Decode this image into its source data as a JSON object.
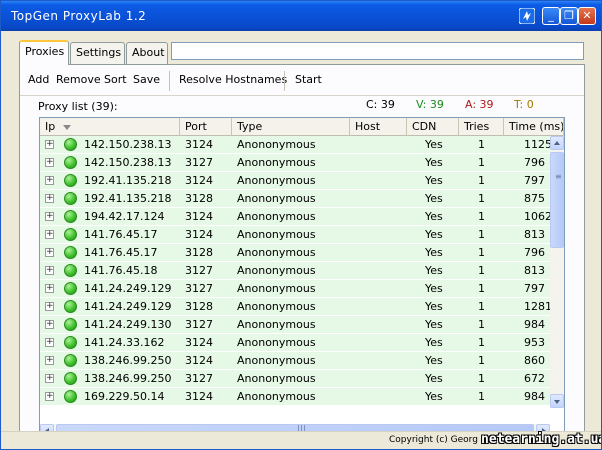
{
  "window": {
    "title": "TopGen ProxyLab 1.2",
    "controls": {
      "minimize": "_",
      "maximize": "❐",
      "close": "✕"
    }
  },
  "tabs": [
    {
      "label": "Proxies",
      "active": true
    },
    {
      "label": "Settings",
      "active": false
    },
    {
      "label": "About",
      "active": false
    }
  ],
  "top_input": {
    "value": ""
  },
  "toolbar": {
    "add": "Add",
    "remove": "Remove",
    "sort": "Sort",
    "save": "Save",
    "resolve": "Resolve Hostnames",
    "start": "Start"
  },
  "proxy_list": {
    "label": "Proxy list (39):",
    "counts": {
      "c": "C: 39",
      "v": "V: 39",
      "a": "A: 39",
      "t": "T: 0"
    },
    "count_colors": {
      "c": "#000000",
      "v": "#1a8a1a",
      "a": "#b01818",
      "t": "#a07a00"
    },
    "columns": [
      "Ip",
      "Port",
      "Type",
      "Host",
      "CDN",
      "Tries",
      "Time (ms)"
    ],
    "rows": [
      {
        "ip": "142.150.238.13",
        "port": "3124",
        "type": "Anononymous",
        "host": "",
        "cdn": "Yes",
        "tries": "1",
        "time": "1125"
      },
      {
        "ip": "142.150.238.13",
        "port": "3127",
        "type": "Anononymous",
        "host": "",
        "cdn": "Yes",
        "tries": "1",
        "time": "796"
      },
      {
        "ip": "192.41.135.218",
        "port": "3124",
        "type": "Anononymous",
        "host": "",
        "cdn": "Yes",
        "tries": "1",
        "time": "797"
      },
      {
        "ip": "192.41.135.218",
        "port": "3128",
        "type": "Anononymous",
        "host": "",
        "cdn": "Yes",
        "tries": "1",
        "time": "875"
      },
      {
        "ip": "194.42.17.124",
        "port": "3124",
        "type": "Anononymous",
        "host": "",
        "cdn": "Yes",
        "tries": "1",
        "time": "1062"
      },
      {
        "ip": "141.76.45.17",
        "port": "3124",
        "type": "Anononymous",
        "host": "",
        "cdn": "Yes",
        "tries": "1",
        "time": "813"
      },
      {
        "ip": "141.76.45.17",
        "port": "3128",
        "type": "Anononymous",
        "host": "",
        "cdn": "Yes",
        "tries": "1",
        "time": "796"
      },
      {
        "ip": "141.76.45.18",
        "port": "3127",
        "type": "Anononymous",
        "host": "",
        "cdn": "Yes",
        "tries": "1",
        "time": "813"
      },
      {
        "ip": "141.24.249.129",
        "port": "3127",
        "type": "Anononymous",
        "host": "",
        "cdn": "Yes",
        "tries": "1",
        "time": "797"
      },
      {
        "ip": "141.24.249.129",
        "port": "3128",
        "type": "Anononymous",
        "host": "",
        "cdn": "Yes",
        "tries": "1",
        "time": "1281"
      },
      {
        "ip": "141.24.249.130",
        "port": "3127",
        "type": "Anononymous",
        "host": "",
        "cdn": "Yes",
        "tries": "1",
        "time": "984"
      },
      {
        "ip": "141.24.33.162",
        "port": "3124",
        "type": "Anononymous",
        "host": "",
        "cdn": "Yes",
        "tries": "1",
        "time": "953"
      },
      {
        "ip": "138.246.99.250",
        "port": "3124",
        "type": "Anononymous",
        "host": "",
        "cdn": "Yes",
        "tries": "1",
        "time": "860"
      },
      {
        "ip": "138.246.99.250",
        "port": "3127",
        "type": "Anononymous",
        "host": "",
        "cdn": "Yes",
        "tries": "1",
        "time": "672"
      },
      {
        "ip": "169.229.50.14",
        "port": "3124",
        "type": "Anononymous",
        "host": "",
        "cdn": "Yes",
        "tries": "1",
        "time": "984"
      }
    ]
  },
  "status": {
    "copyright": "Copyright (c) Georg",
    "watermark": "netearning.at.ua"
  }
}
